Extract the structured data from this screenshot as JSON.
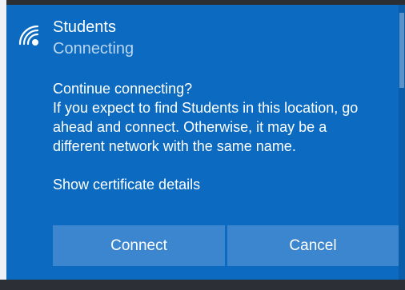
{
  "network": {
    "name": "Students",
    "status": "Connecting"
  },
  "dialog": {
    "question": "Continue connecting?",
    "body": "If you expect to find Students in this location, go ahead and connect. Otherwise, it may be a different network with the same name.",
    "certificate_link": "Show certificate details"
  },
  "buttons": {
    "connect": "Connect",
    "cancel": "Cancel"
  },
  "icons": {
    "network": "wifi-icon"
  },
  "colors": {
    "panel_background": "#0c6bc1",
    "button_background": "#3b86cf",
    "status_text": "#b9d6f0"
  }
}
